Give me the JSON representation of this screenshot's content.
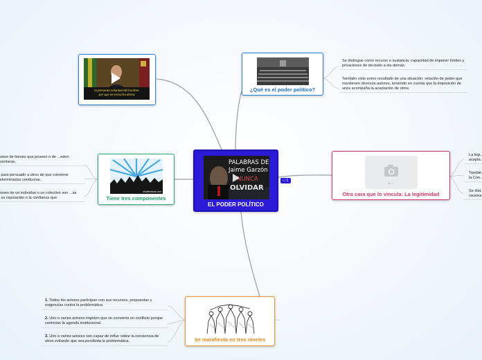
{
  "central": {
    "title": "EL PODER POLÍTICO",
    "image_text": [
      "PALABRAS DE",
      "Jaime Garzón",
      "NUNCA",
      "OLVIDAR"
    ]
  },
  "video_node": {
    "subtitle": [
      "la presunta voluntad del hombre",
      "por que se escucha ahora"
    ]
  },
  "que_es": {
    "title": "¿Qué es el poder político?",
    "items": [
      "Se distingue como recurso o sustancia: capacidad de imponer límites y privaciones de decisión a los demás.",
      "También visto como resultado de una situación: relación de poder que mantienen diversos autores, teniendo en cuenta que la imposición de unos acompaña la aceptación de otros."
    ]
  },
  "componentes": {
    "title": "Tiene tres componentes",
    "image_caption": "shutterstock.com",
    "items": [
      "...gunos de bienes que poseen o de ...eden presentarse,",
      "...d para persuadir a otros de que conviene ...determinadas conductas.",
      "...ciones de un individuo o un colectivo son ...ás por su reputación o la confianza que"
    ]
  },
  "legitimidad": {
    "title": "Otra cara que lo vincula: La legitimidad",
    "items": [
      "La legi... acepta...",
      "Tambié... la Con...",
      "Se dist... raciona..."
    ]
  },
  "niveles": {
    "title": "Se manifiesta en tres niveles",
    "items": [
      {
        "num": "1.",
        "text": "Todos los actores participan con sus recursos, propuestas y exigencias contra la problemática."
      },
      {
        "num": "2.",
        "text": "Uno o varios actores impiden que se convierta en conflicto porque controlan la agenda institucional."
      },
      {
        "num": "3.",
        "text": "Uno o varios actores son capaz de influir sobre la conciencia de otros evitando que sea percibida la problemática."
      }
    ]
  },
  "badge": "1",
  "colors": {
    "central": "#2b1bd6",
    "blue_border": "#2f7dd1",
    "blue_text": "#1a6ec2",
    "green_border": "#2aa873",
    "green_text": "#1e9a6a",
    "red_border": "#c8366b",
    "red_text": "#c8366b",
    "orange_border": "#e8962d",
    "orange_text": "#e08a1c",
    "link": "#9aa3ad"
  },
  "icons": {
    "video": "play-icon",
    "placeholder": "camera-icon",
    "note": "note-icon"
  }
}
